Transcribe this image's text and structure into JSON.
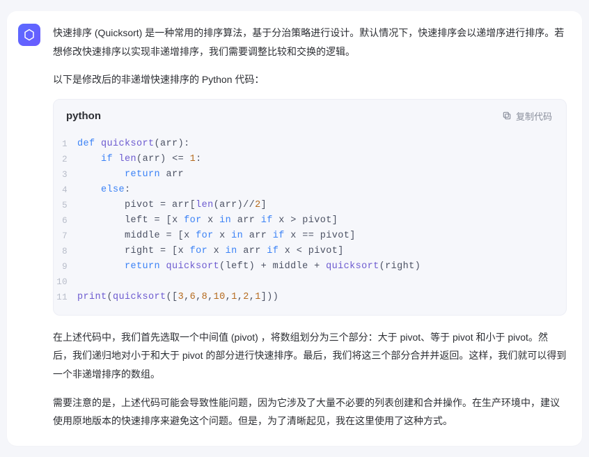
{
  "intro1": "快速排序 (Quicksort) 是一种常用的排序算法，基于分治策略进行设计。默认情况下，快速排序会以递增序进行排序。若想修改快速排序以实现非递增排序，我们需要调整比较和交换的逻辑。",
  "intro2": "以下是修改后的非递增快速排序的 Python 代码：",
  "code": {
    "language": "python",
    "copy_label": "复制代码",
    "lines": [
      {
        "n": "1",
        "tokens": [
          [
            "kw",
            "def "
          ],
          [
            "fn",
            "quicksort"
          ],
          [
            "op",
            "("
          ],
          [
            "var",
            "arr"
          ],
          [
            "op",
            ")"
          ],
          [
            "op",
            ":"
          ]
        ]
      },
      {
        "n": "2",
        "tokens": [
          [
            "op",
            "    "
          ],
          [
            "kw",
            "if "
          ],
          [
            "fn",
            "len"
          ],
          [
            "op",
            "("
          ],
          [
            "var",
            "arr"
          ],
          [
            "op",
            ")"
          ],
          [
            "op",
            " <= "
          ],
          [
            "num",
            "1"
          ],
          [
            "op",
            ":"
          ]
        ]
      },
      {
        "n": "3",
        "tokens": [
          [
            "op",
            "        "
          ],
          [
            "kw",
            "return "
          ],
          [
            "var",
            "arr"
          ]
        ]
      },
      {
        "n": "4",
        "tokens": [
          [
            "op",
            "    "
          ],
          [
            "kw",
            "else"
          ],
          [
            "op",
            ":"
          ]
        ]
      },
      {
        "n": "5",
        "tokens": [
          [
            "op",
            "        "
          ],
          [
            "var",
            "pivot"
          ],
          [
            "op",
            " = "
          ],
          [
            "var",
            "arr"
          ],
          [
            "op",
            "["
          ],
          [
            "fn",
            "len"
          ],
          [
            "op",
            "("
          ],
          [
            "var",
            "arr"
          ],
          [
            "op",
            ")"
          ],
          [
            "op",
            "//"
          ],
          [
            "num",
            "2"
          ],
          [
            "op",
            "]"
          ]
        ]
      },
      {
        "n": "6",
        "tokens": [
          [
            "op",
            "        "
          ],
          [
            "var",
            "left"
          ],
          [
            "op",
            " = "
          ],
          [
            "op",
            "["
          ],
          [
            "var",
            "x"
          ],
          [
            "op",
            " "
          ],
          [
            "kw",
            "for"
          ],
          [
            "op",
            " "
          ],
          [
            "var",
            "x"
          ],
          [
            "op",
            " "
          ],
          [
            "kw",
            "in"
          ],
          [
            "op",
            " "
          ],
          [
            "var",
            "arr"
          ],
          [
            "op",
            " "
          ],
          [
            "kw",
            "if"
          ],
          [
            "op",
            " "
          ],
          [
            "var",
            "x"
          ],
          [
            "op",
            " > "
          ],
          [
            "var",
            "pivot"
          ],
          [
            "op",
            "]"
          ]
        ]
      },
      {
        "n": "7",
        "tokens": [
          [
            "op",
            "        "
          ],
          [
            "var",
            "middle"
          ],
          [
            "op",
            " = "
          ],
          [
            "op",
            "["
          ],
          [
            "var",
            "x"
          ],
          [
            "op",
            " "
          ],
          [
            "kw",
            "for"
          ],
          [
            "op",
            " "
          ],
          [
            "var",
            "x"
          ],
          [
            "op",
            " "
          ],
          [
            "kw",
            "in"
          ],
          [
            "op",
            " "
          ],
          [
            "var",
            "arr"
          ],
          [
            "op",
            " "
          ],
          [
            "kw",
            "if"
          ],
          [
            "op",
            " "
          ],
          [
            "var",
            "x"
          ],
          [
            "op",
            " == "
          ],
          [
            "var",
            "pivot"
          ],
          [
            "op",
            "]"
          ]
        ]
      },
      {
        "n": "8",
        "tokens": [
          [
            "op",
            "        "
          ],
          [
            "var",
            "right"
          ],
          [
            "op",
            " = "
          ],
          [
            "op",
            "["
          ],
          [
            "var",
            "x"
          ],
          [
            "op",
            " "
          ],
          [
            "kw",
            "for"
          ],
          [
            "op",
            " "
          ],
          [
            "var",
            "x"
          ],
          [
            "op",
            " "
          ],
          [
            "kw",
            "in"
          ],
          [
            "op",
            " "
          ],
          [
            "var",
            "arr"
          ],
          [
            "op",
            " "
          ],
          [
            "kw",
            "if"
          ],
          [
            "op",
            " "
          ],
          [
            "var",
            "x"
          ],
          [
            "op",
            " < "
          ],
          [
            "var",
            "pivot"
          ],
          [
            "op",
            "]"
          ]
        ]
      },
      {
        "n": "9",
        "tokens": [
          [
            "op",
            "        "
          ],
          [
            "kw",
            "return "
          ],
          [
            "fn",
            "quicksort"
          ],
          [
            "op",
            "("
          ],
          [
            "var",
            "left"
          ],
          [
            "op",
            ")"
          ],
          [
            "op",
            " + "
          ],
          [
            "var",
            "middle"
          ],
          [
            "op",
            " + "
          ],
          [
            "fn",
            "quicksort"
          ],
          [
            "op",
            "("
          ],
          [
            "var",
            "right"
          ],
          [
            "op",
            ")"
          ]
        ]
      },
      {
        "n": "10",
        "tokens": []
      },
      {
        "n": "11",
        "tokens": [
          [
            "fn",
            "print"
          ],
          [
            "op",
            "("
          ],
          [
            "fn",
            "quicksort"
          ],
          [
            "op",
            "(["
          ],
          [
            "num",
            "3"
          ],
          [
            "op",
            ","
          ],
          [
            "num",
            "6"
          ],
          [
            "op",
            ","
          ],
          [
            "num",
            "8"
          ],
          [
            "op",
            ","
          ],
          [
            "num",
            "10"
          ],
          [
            "op",
            ","
          ],
          [
            "num",
            "1"
          ],
          [
            "op",
            ","
          ],
          [
            "num",
            "2"
          ],
          [
            "op",
            ","
          ],
          [
            "num",
            "1"
          ],
          [
            "op",
            "]))"
          ]
        ]
      }
    ]
  },
  "outro1": "在上述代码中，我们首先选取一个中间值 (pivot) ，将数组划分为三个部分：大于 pivot、等于 pivot 和小于 pivot。然后，我们递归地对小于和大于 pivot 的部分进行快速排序。最后，我们将这三个部分合并并返回。这样，我们就可以得到一个非递增排序的数组。",
  "outro2": "需要注意的是，上述代码可能会导致性能问题，因为它涉及了大量不必要的列表创建和合并操作。在生产环境中，建议使用原地版本的快速排序来避免这个问题。但是，为了清晰起见，我在这里使用了这种方式。"
}
